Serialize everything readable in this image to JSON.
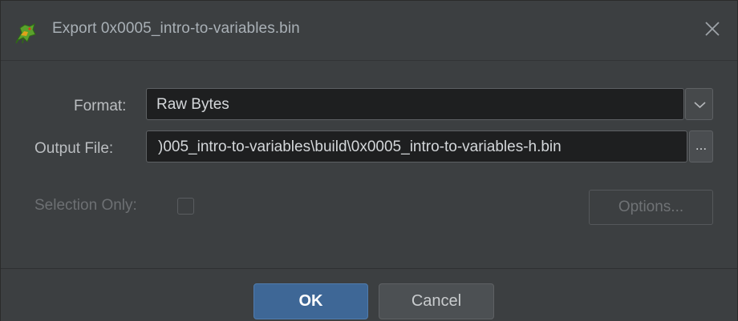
{
  "window": {
    "title": "Export 0x0005_intro-to-variables.bin",
    "app_icon": "ghidra-dragon-icon",
    "close_icon": "close-icon"
  },
  "form": {
    "format_label": "Format:",
    "format_value": "Raw Bytes",
    "output_label": "Output File:",
    "output_value": ")005_intro-to-variables\\build\\0x0005_intro-to-variables-h.bin",
    "browse_label": "...",
    "selection_label": "Selection Only:",
    "selection_checked": false,
    "options_label": "Options..."
  },
  "footer": {
    "ok_label": "OK",
    "cancel_label": "Cancel"
  },
  "colors": {
    "background": "#3c3f41",
    "field_bg": "#1e1f20",
    "accent": "#3e6796"
  }
}
